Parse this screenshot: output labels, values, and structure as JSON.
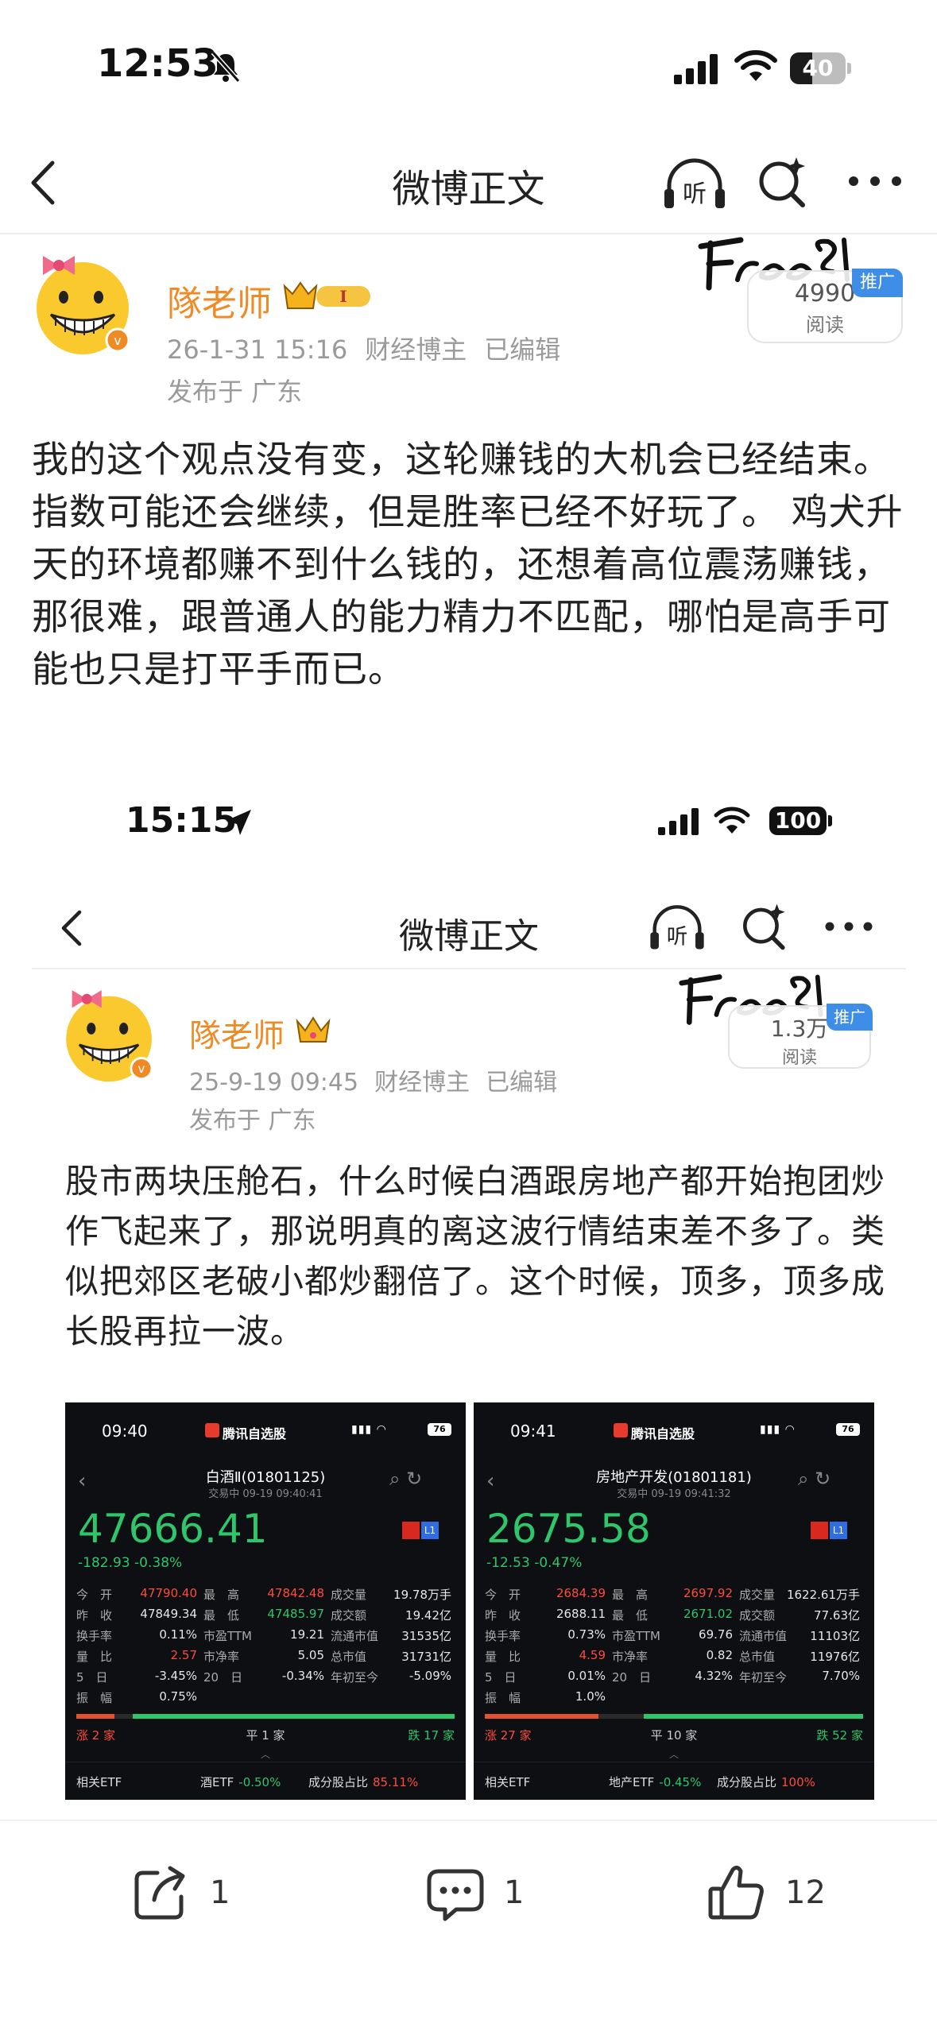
{
  "status_bar": {
    "time": "12:53",
    "battery": "40",
    "battery_level": 0.4
  },
  "nav": {
    "title": "微博正文"
  },
  "post": {
    "author": "隊老师",
    "date": "26-1-31 15:16",
    "category": "财经博主",
    "edited": "已编辑",
    "location": "发布于 广东",
    "read_count": "4990",
    "read_label": "阅读",
    "promo": "推广",
    "body": "我的这个观点没有变，这轮赚钱的大机会已经结束。指数可能还会继续，但是胜率已经不好玩了。 鸡犬升天的环境都赚不到什么钱的，还想着高位震荡赚钱，那很难，跟普通人的能力精力不匹配，哪怕是高手可能也只是打平手而已。"
  },
  "embedded": {
    "status_bar": {
      "time": "15:15",
      "battery": "100"
    },
    "nav": {
      "title": "微博正文"
    },
    "post": {
      "author": "隊老师",
      "date": "25-9-19 09:45",
      "category": "财经博主",
      "edited": "已编辑",
      "location": "发布于 广东",
      "read_count": "1.3万",
      "read_label": "阅读",
      "promo": "推广",
      "body": "股市两块压舱石，什么时候白酒跟房地产都开始抱团炒作飞起来了，那说明真的离这波行情结束差不多了。类似把郊区老破小都炒翻倍了。这个时候，顶多，顶多成长股再拉一波。"
    },
    "stocks": [
      {
        "time": "09:40",
        "app": "腾讯自选股",
        "battery": "76",
        "name": "白酒Ⅱ(01801125)",
        "sub": "交易中  09-19 09:40:41",
        "price": "47666.41",
        "change": "-182.93  -0.38%",
        "rows": [
          [
            [
              "今　开",
              "47790.40",
              "red"
            ],
            [
              "最　高",
              "47842.48",
              "red"
            ],
            [
              "成交量",
              "19.78万手",
              ""
            ]
          ],
          [
            [
              "昨　收",
              "47849.34",
              ""
            ],
            [
              "最　低",
              "47485.97",
              "grn"
            ],
            [
              "成交额",
              "19.42亿",
              ""
            ]
          ],
          [
            [
              "换手率",
              "0.11%",
              ""
            ],
            [
              "市盈TTM",
              "19.21",
              ""
            ],
            [
              "流通市值",
              "31535亿",
              ""
            ]
          ],
          [
            [
              "量　比",
              "2.57",
              "red"
            ],
            [
              "市净率",
              "5.05",
              ""
            ],
            [
              "总市值",
              "31731亿",
              ""
            ]
          ],
          [
            [
              "5　日",
              "-3.45%",
              ""
            ],
            [
              "20　日",
              "-0.34%",
              ""
            ],
            [
              "年初至今",
              "-5.09%",
              ""
            ]
          ],
          [
            [
              "振　幅",
              "0.75%",
              ""
            ],
            [
              "",
              "",
              " "
            ],
            [
              "",
              "",
              " "
            ]
          ]
        ],
        "up": "涨 2 家",
        "flat": "平 1 家",
        "down": "跌 17 家",
        "up_ratio": 0.1,
        "down_ratio": 0.85,
        "etf_label": "相关ETF",
        "etf_name": "酒ETF",
        "etf_change": "-0.50%",
        "share_label": "成分股占比",
        "share_value": "85.11%"
      },
      {
        "time": "09:41",
        "app": "腾讯自选股",
        "battery": "76",
        "name": "房地产开发(01801181)",
        "sub": "交易中  09-19 09:41:32",
        "price": "2675.58",
        "change": "-12.53  -0.47%",
        "rows": [
          [
            [
              "今　开",
              "2684.39",
              "red"
            ],
            [
              "最　高",
              "2697.92",
              "red"
            ],
            [
              "成交量",
              "1622.61万手",
              ""
            ]
          ],
          [
            [
              "昨　收",
              "2688.11",
              ""
            ],
            [
              "最　低",
              "2671.02",
              "grn"
            ],
            [
              "成交额",
              "77.63亿",
              ""
            ]
          ],
          [
            [
              "换手率",
              "0.73%",
              ""
            ],
            [
              "市盈TTM",
              "69.76",
              ""
            ],
            [
              "流通市值",
              "11103亿",
              ""
            ]
          ],
          [
            [
              "量　比",
              "4.59",
              "red"
            ],
            [
              "市净率",
              "0.82",
              ""
            ],
            [
              "总市值",
              "11976亿",
              ""
            ]
          ],
          [
            [
              "5　日",
              "0.01%",
              ""
            ],
            [
              "20　日",
              "4.32%",
              ""
            ],
            [
              "年初至今",
              "7.70%",
              ""
            ]
          ],
          [
            [
              "振　幅",
              "1.0%",
              ""
            ],
            [
              "",
              "",
              " "
            ],
            [
              "",
              "",
              " "
            ]
          ]
        ],
        "up": "涨 27 家",
        "flat": "平 10 家",
        "down": "跌 52 家",
        "up_ratio": 0.3,
        "down_ratio": 0.58,
        "etf_label": "相关ETF",
        "etf_name": "地产ETF",
        "etf_change": "-0.45%",
        "share_label": "成分股占比",
        "share_value": "100%"
      }
    ]
  },
  "actions": {
    "share_count": "1",
    "comment_count": "1",
    "like_count": "12"
  },
  "icons": {
    "bell": "bell-slash-icon",
    "signal": "signal-icon",
    "wifi": "wifi-icon",
    "back": "back-arrow-icon",
    "listen": "headphones-listen-icon",
    "search": "search-sparkle-icon",
    "more": "more-dots-icon",
    "share": "share-icon",
    "comment": "comment-icon",
    "like": "thumbs-up-icon"
  },
  "colors": {
    "author": "#f08a24",
    "meta": "#9a9a9a",
    "promo": "#3e8de6",
    "stock_up": "#ff4b3e",
    "stock_down": "#2fc56a"
  }
}
